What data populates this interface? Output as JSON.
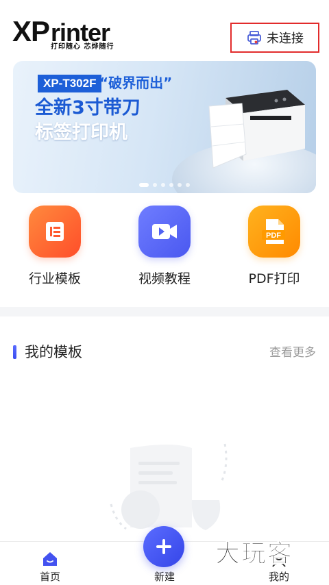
{
  "header": {
    "logo_main_xp": "XP",
    "logo_main_rest": "rinter",
    "logo_sub": "打印随心 芯烨随行",
    "connect_label": "未连接",
    "connect_icon": "printer-icon"
  },
  "banner": {
    "tag": "XP-T302F",
    "quote": "“破界而出”",
    "line1": "全新3寸带刀",
    "line2": "标签打印机",
    "slide_count": 6,
    "active_slide": 0
  },
  "quick_actions": [
    {
      "label": "行业模板",
      "icon": "template-list-icon",
      "color": "#ff6a33"
    },
    {
      "label": "视频教程",
      "icon": "video-camera-icon",
      "color": "#5a68f8"
    },
    {
      "label": "PDF打印",
      "icon": "pdf-file-icon",
      "color": "#ffa010"
    }
  ],
  "section": {
    "title": "我的模板",
    "more": "查看更多"
  },
  "tabbar": {
    "home": "首页",
    "new": "新建",
    "mine": "我的",
    "active": "home",
    "accent": "#4352f0"
  },
  "watermark": "大玩客"
}
